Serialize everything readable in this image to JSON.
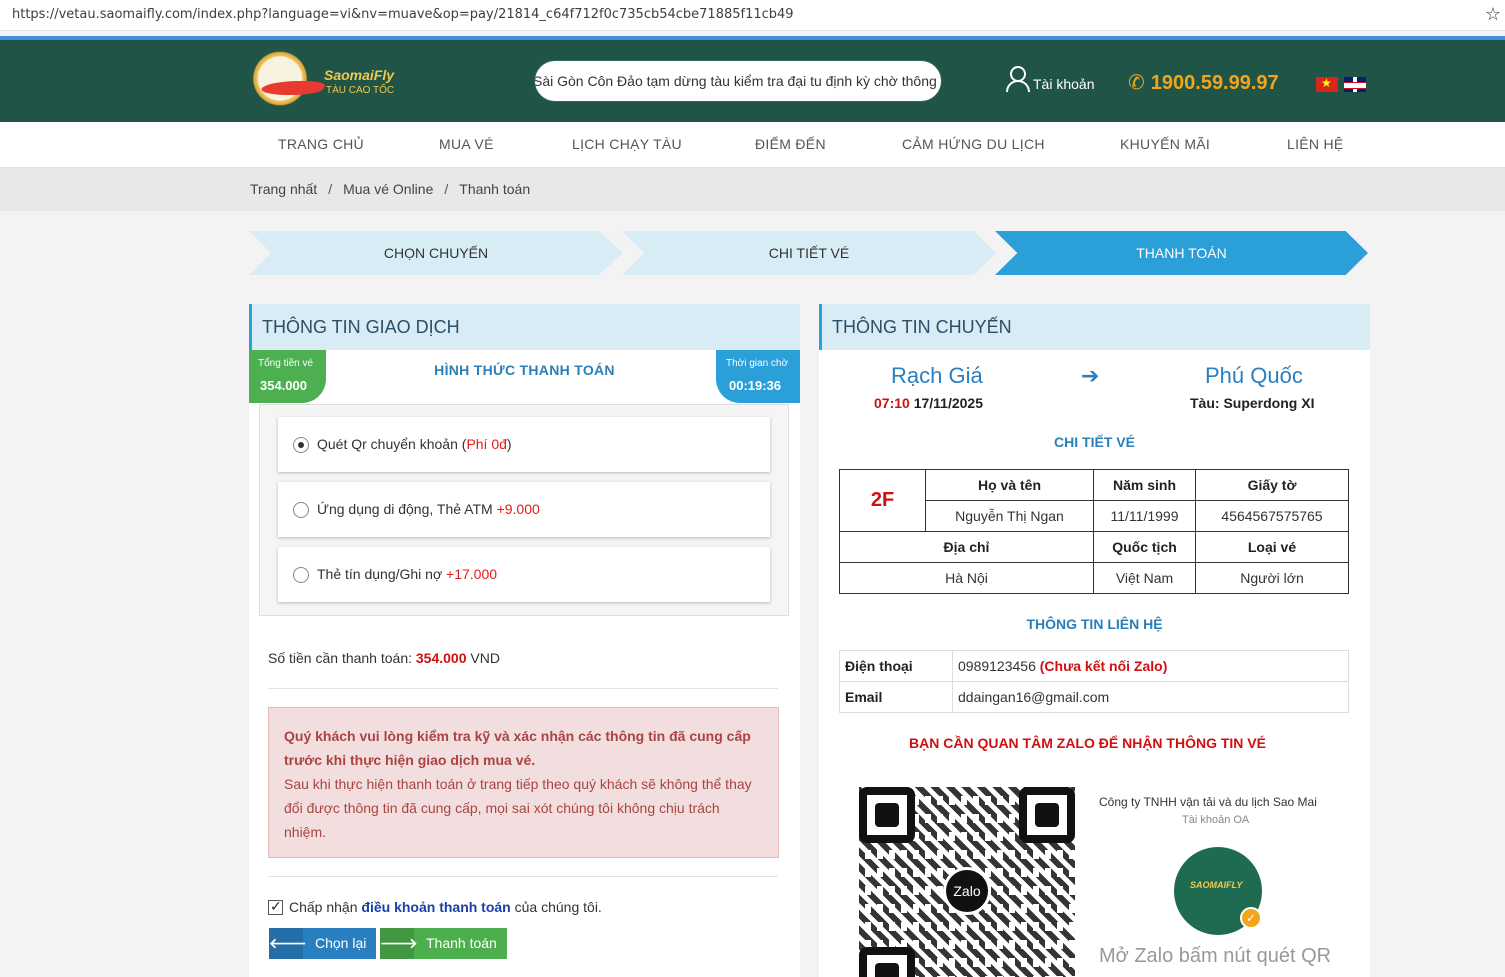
{
  "browser": {
    "url": "https://vetau.saomaifly.com/index.php?language=vi&nv=muave&op=pay/21814_c64f712f0c735cb54cbe71885f11cb49"
  },
  "header": {
    "brand": "SaomaiFly",
    "brand_sub": "TÀU CAO TỐC",
    "ticker": "Sài Gòn Côn Đảo tạm dừng tàu kiểm tra đại tu định kỳ chờ thông báo",
    "account_label": "Tài khoản",
    "hotline": "1900.59.99.97"
  },
  "nav": {
    "items": [
      "TRANG CHỦ",
      "MUA VÉ",
      "LỊCH CHẠY TÀU",
      "ĐIỂM ĐẾN",
      "CẢM HỨNG DU LỊCH",
      "KHUYẾN MÃI",
      "LIÊN HỆ"
    ]
  },
  "breadcrumb": [
    "Trang nhất",
    "Mua vé Online",
    "Thanh toán"
  ],
  "steps": [
    "CHỌN CHUYẾN",
    "CHI TIẾT VÉ",
    "THANH TOÁN"
  ],
  "transaction": {
    "title": "THÔNG TIN GIAO DỊCH",
    "total_label": "Tổng tiền vé",
    "total_value": "354.000",
    "timer_label": "Thời gian chờ",
    "timer_value": "00:19:36",
    "pay_method_title": "HÌNH THỨC THANH TOÁN",
    "options": [
      {
        "label": "Quét Qr chuyển khoản",
        "fee_open": "(",
        "fee": "Phí 0đ",
        "fee_close": ")",
        "selected": true
      },
      {
        "label": "Ứng dụng di động, Thẻ ATM",
        "fee": "+9.000",
        "selected": false
      },
      {
        "label": "Thẻ tín dụng/Ghi nợ",
        "fee": "+17.000",
        "selected": false
      }
    ],
    "amount_label": "Số tiền cần thanh toán:",
    "amount_value": "354.000",
    "amount_currency": "VND",
    "alert_bold": "Quý khách vui lòng kiểm tra kỹ và xác nhận các thông tin đã cung cấp trước khi thực hiện giao dịch mua vé.",
    "alert_text": "Sau khi thực hiện thanh toán ở trang tiếp theo quý khách sẽ không thể thay đổi được thông tin đã cung cấp, mọi sai xót chúng tôi không chịu trách nhiệm.",
    "agree_prefix": "Chấp nhận",
    "agree_link": "điều khoản thanh toán",
    "agree_suffix": "của chúng tôi.",
    "back_button": "Chọn lại",
    "pay_button": "Thanh toán"
  },
  "trip": {
    "title": "THÔNG TIN CHUYẾN",
    "from": "Rạch Giá",
    "to": "Phú Quốc",
    "dep_time": "07:10",
    "dep_date": "17/11/2025",
    "ship_label": "Tàu:",
    "ship_name": "Superdong XI",
    "ticket_title": "CHI TIẾT VÉ",
    "seat": "2F",
    "headers1": [
      "Họ và tên",
      "Năm sinh",
      "Giấy tờ"
    ],
    "values1": [
      "Nguyễn Thị Ngan",
      "11/11/1999",
      "4564567575765"
    ],
    "headers2": [
      "Địa chỉ",
      "Quốc tịch",
      "Loại vé"
    ],
    "values2": [
      "Hà Nội",
      "Việt Nam",
      "Người lớn"
    ],
    "contact_title": "THÔNG TIN LIÊN HỆ",
    "phone_label": "Điện thoại",
    "phone_value": "0989123456",
    "phone_note": "(Chưa kết nối Zalo)",
    "email_label": "Email",
    "email_value": "ddaingan16@gmail.com",
    "zalo_warning": "BẠN CẦN QUAN TÂM ZALO ĐỂ NHẬN THÔNG TIN VÉ",
    "qr_badge": "Zalo",
    "oa_name": "Công ty TNHH vận tải  và du lịch Sao Mai",
    "oa_sub": "Tài khoản OA",
    "oa_logo_text": "SAOMAIFLY",
    "oa_hint": "Mở Zalo bấm nút quét QR"
  },
  "colors": {
    "header_bg": "#1f5447",
    "accent_blue": "#2a9fd8",
    "hotline": "#f2a51a",
    "alert_bg": "#f2dede",
    "price_red": "#d01010"
  }
}
